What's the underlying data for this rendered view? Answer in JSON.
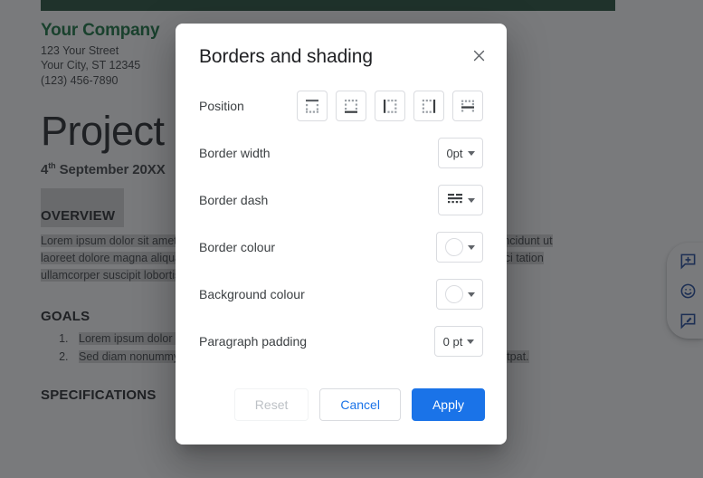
{
  "document": {
    "banner_color": "#1e4d36",
    "company": {
      "name": "Your Company",
      "street": "123 Your Street",
      "city": "Your City, ST 12345",
      "phone": "(123) 456-7890",
      "name_color": "#10703a"
    },
    "title": "Project",
    "date_day": "4",
    "date_ordinal": "th",
    "date_rest": " September 20XX",
    "sections": {
      "overview_heading": "OVERVIEW",
      "overview_body": "Lorem ipsum dolor sit amet, consectetuer adipiscing elit, sed diam nonummy nibh euismod tincidunt ut laoreet dolore magna aliquam erat volutpat. Ut wisi enim ad minim veniam, quis nostrud exerci tation ullamcorper suscipit lobortis nisl ut aliquip ex ea commodo.",
      "goals_heading": "GOALS",
      "goals": [
        "Lorem ipsum dolor sit amet, consectetuer adipiscing elit.",
        "Sed diam nonummy nibh euismod tincidunt ut laoreet dolore magna aliquam erat volutpat."
      ],
      "specifications_heading": "SPECIFICATIONS"
    }
  },
  "action_rail": {
    "add_comment": "add-comment-icon",
    "add_reaction": "emoji-reaction-icon",
    "suggest_edit": "suggest-edit-icon",
    "icon_color": "#1b459b"
  },
  "dialog": {
    "title": "Borders and shading",
    "close_icon": "close-icon",
    "rows": {
      "position": {
        "label": "Position",
        "options": [
          {
            "name": "border-top",
            "icon": "border-top-icon"
          },
          {
            "name": "border-bottom",
            "icon": "border-bottom-icon"
          },
          {
            "name": "border-left",
            "icon": "border-left-icon"
          },
          {
            "name": "border-right",
            "icon": "border-right-icon"
          },
          {
            "name": "border-inner-horizontal",
            "icon": "border-inner-horizontal-icon"
          }
        ]
      },
      "border_width": {
        "label": "Border width",
        "value": "0pt"
      },
      "border_dash": {
        "label": "Border dash",
        "value": "dash-pattern-icon"
      },
      "border_colour": {
        "label": "Border colour",
        "value": "#ffffff"
      },
      "background_colour": {
        "label": "Background colour",
        "value": "#ffffff"
      },
      "paragraph_padding": {
        "label": "Paragraph padding",
        "value": "0 pt"
      }
    },
    "buttons": {
      "reset": "Reset",
      "cancel": "Cancel",
      "apply": "Apply"
    },
    "accent_color": "#1a73e8"
  }
}
